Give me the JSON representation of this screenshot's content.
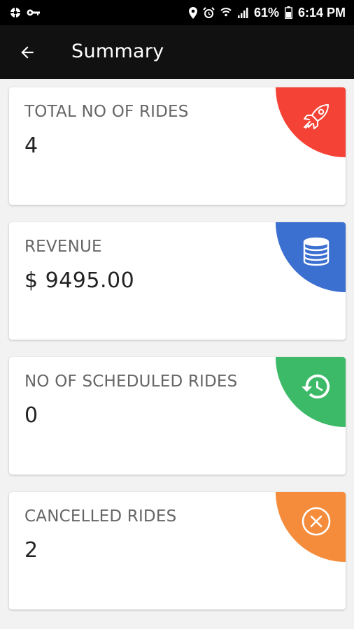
{
  "status_bar": {
    "battery_percent": "61%",
    "time": "6:14 PM"
  },
  "app_bar": {
    "title": "Summary",
    "back_icon": "arrow-back-icon"
  },
  "cards": [
    {
      "label": "TOTAL NO OF RIDES",
      "value": "4",
      "icon": "rocket-icon",
      "color": "#f44336"
    },
    {
      "label": "REVENUE",
      "value": "$ 9495.00",
      "icon": "coins-icon",
      "color": "#3b6fd0"
    },
    {
      "label": "NO OF SCHEDULED RIDES",
      "value": "0",
      "icon": "history-icon",
      "color": "#3dba68"
    },
    {
      "label": "CANCELLED RIDES",
      "value": "2",
      "icon": "cancel-circle-icon",
      "color": "#f48c3c"
    }
  ]
}
